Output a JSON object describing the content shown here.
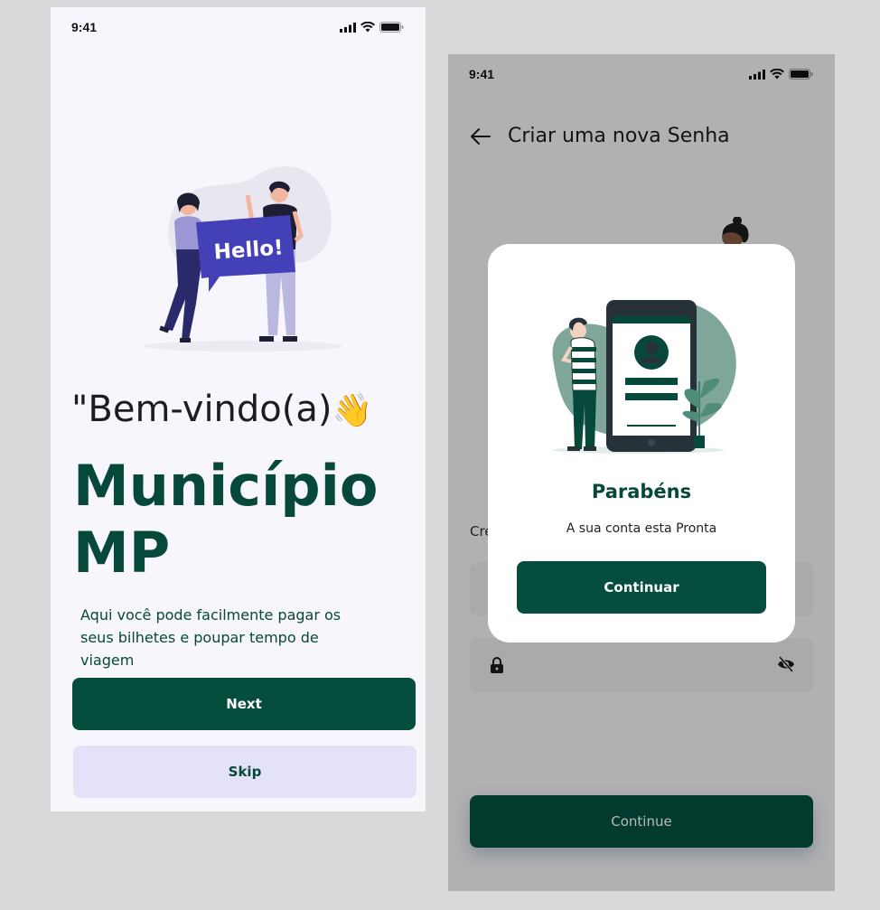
{
  "onboarding": {
    "status_time": "9:41",
    "illustration_text": "Hello!",
    "welcome_text": "\"Bem-vindo(a)",
    "wave_emoji": "👋",
    "brand_line1": "Município",
    "brand_line2": "MP",
    "description": "Aqui você pode facilmente pagar os seus bilhetes e poupar tempo de viagem",
    "next_label": "Next",
    "skip_label": "Skip"
  },
  "new_password": {
    "status_time": "9:41",
    "title": "Criar uma nova Senha",
    "create_label_partial": "Cre",
    "continue_label": "Continue",
    "modal": {
      "title": "Parabéns",
      "subtitle": "A sua conta esta Pronta",
      "button_label": "Continuar"
    }
  },
  "colors": {
    "primary": "#054d3c",
    "skip_bg": "#e4e2f8",
    "screen_bg": "#f7f6fc"
  }
}
